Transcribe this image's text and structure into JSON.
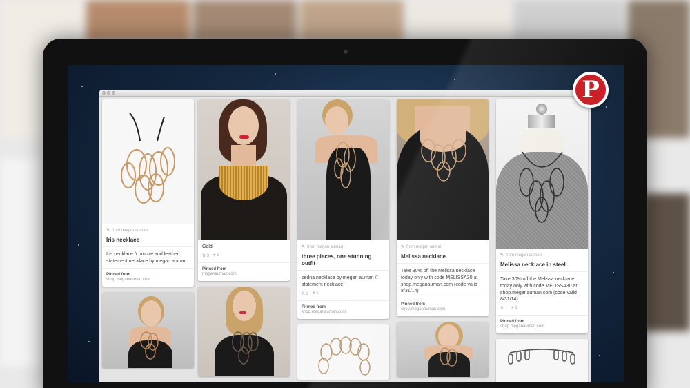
{
  "brand": {
    "logo_icon": "pinterest-logo-icon",
    "accent": "#cb2027"
  },
  "columns": [
    {
      "pins": [
        {
          "image": "necklace-bronze-loops-photo",
          "from": "from megan auman",
          "title": "Iris necklace",
          "description": "Iris necklace // bronze and leather statement necklace by megan auman",
          "pinned_label": "Pinned from",
          "pinned_site": "shop.meganauman.com"
        },
        {
          "image": "model-blonde-necklace-photo"
        }
      ]
    },
    {
      "pins": [
        {
          "image": "model-brunette-gold-collar-photo",
          "title": "Gold!",
          "repins": "3",
          "likes": "1",
          "pinned_label": "Pinned from",
          "pinned_site": "meganauman.com"
        },
        {
          "image": "model-blonde-dark-necklace-photo"
        }
      ]
    },
    {
      "pins": [
        {
          "image": "model-grey-backdrop-necklace-photo",
          "from": "from megan auman",
          "title": "three pieces, one stunning outfit",
          "description": "sedna necklace by megan auman // statement necklace",
          "repins": "2",
          "likes": "1",
          "pinned_label": "Pinned from",
          "pinned_site": "shop.meganauman.com"
        },
        {
          "image": "necklace-silver-chain-photo"
        }
      ]
    },
    {
      "pins": [
        {
          "image": "model-melissa-necklace-photo",
          "from": "from megan auman",
          "title": "Melissa necklace",
          "description": "Take 30% off the Melissa necklace today only with code MELISSA30 at shop.meganauman.com (code valid 8/31/14)",
          "pinned_label": "Pinned from",
          "pinned_site": "shop.meganauman.com"
        },
        {
          "image": "model-blonde-bronze-necklace-photo"
        }
      ]
    },
    {
      "pins": [
        {
          "image": "mannequin-steel-necklace-photo",
          "from": "from megan auman",
          "title": "Melissa necklace in steel",
          "description": "Take 30% off the Melissa necklace today only with code MELISSA30 at shop.meganauman.com (code valid 8/31/14)",
          "repins": "1",
          "likes": "1",
          "pinned_label": "Pinned from",
          "pinned_site": "shop.meganauman.com"
        },
        {
          "image": "necklace-silver-links-photo"
        }
      ]
    }
  ]
}
